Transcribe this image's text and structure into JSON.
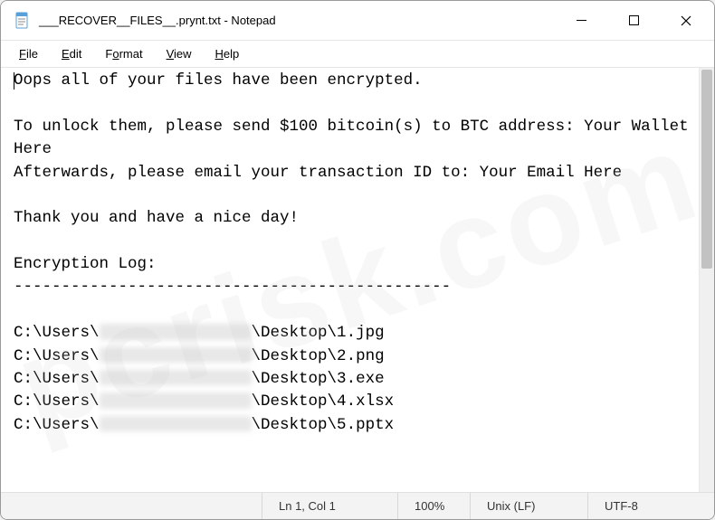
{
  "titlebar": {
    "title": "___RECOVER__FILES__.prynt.txt - Notepad"
  },
  "menubar": {
    "items": [
      {
        "label": "File",
        "u": "F"
      },
      {
        "label": "Edit",
        "u": "E"
      },
      {
        "label": "Format",
        "u": "o"
      },
      {
        "label": "View",
        "u": "V"
      },
      {
        "label": "Help",
        "u": "H"
      }
    ]
  },
  "document": {
    "line1": "Oops all of your files have been encrypted.",
    "blank": "",
    "line2": "To unlock them, please send $100 bitcoin(s) to BTC address: Your Wallet Here",
    "line3": "Afterwards, please email your transaction ID to: Your Email Here",
    "line4": "Thank you and have a nice day!",
    "line5": "Encryption Log:",
    "sep": "----------------------------------------------",
    "files_prefix": "C:\\Users\\",
    "files_redacted": "XXXXXXXXXXXXXXXX",
    "files_mid": "\\Desktop\\",
    "files": [
      "1.jpg",
      "2.png",
      "3.exe",
      "4.xlsx",
      "5.pptx"
    ]
  },
  "statusbar": {
    "position": "Ln 1, Col 1",
    "zoom": "100%",
    "eol": "Unix (LF)",
    "encoding": "UTF-8"
  },
  "watermark": "pcrisk.com"
}
